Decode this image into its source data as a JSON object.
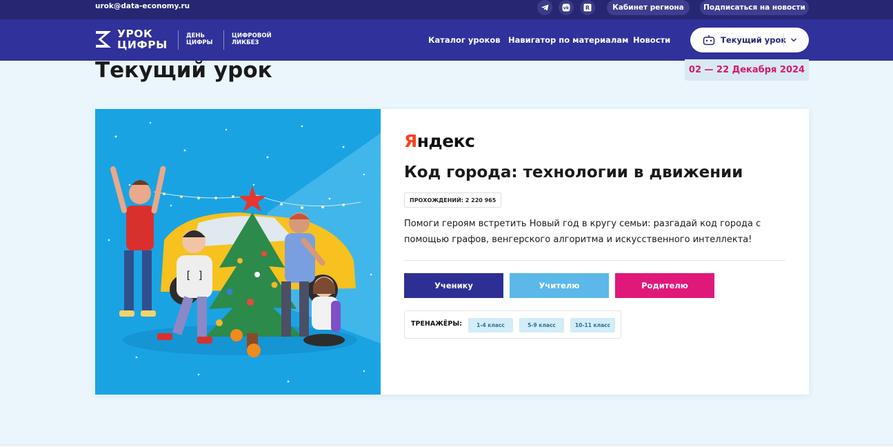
{
  "topbar": {
    "email": "urok@data-economy.ru",
    "social": [
      {
        "name": "telegram-icon",
        "glyph": "➤"
      },
      {
        "name": "vk-icon",
        "glyph": "vk"
      },
      {
        "name": "rutube-icon",
        "glyph": "R"
      }
    ],
    "region_cabinet": "Кабинет региона",
    "subscribe": "Подписаться на новости"
  },
  "header": {
    "logo_line1": "УРОК",
    "logo_line2": "ЦИФРЫ",
    "sub1_line1": "ДЕНЬ",
    "sub1_line2": "ЦИФРЫ",
    "sub2_line1": "ЦИФРОВОЙ",
    "sub2_line2": "ЛИКБЕЗ",
    "nav": [
      "Каталог уроков",
      "Навигатор по материалам",
      "Новости"
    ],
    "current_lesson_button": "Текущий урок"
  },
  "page": {
    "title": "Текущий урок",
    "dates": "02 — 22 Декабря 2024"
  },
  "lesson": {
    "partner_y": "Я",
    "partner_rest": "ндекс",
    "title": "Код города: технологии в движении",
    "passes": "ПРОХОЖДЕНИЙ: 2 220 965",
    "description": "Помоги героям встретить Новый год в кругу семьи: разгадай код города с помощью графов, венгерского алгоритма и искусственного интеллекта!",
    "roles": [
      "Ученику",
      "Учителю",
      "Родителю"
    ],
    "trainers_label": "ТРЕНАЖЁРЫ:",
    "grades": [
      "1-4 класс",
      "5-9 класс",
      "10-11 класс"
    ]
  },
  "colors": {
    "topbar": "#262673",
    "header": "#30319a",
    "student": "#2e2f95",
    "teacher": "#5bb8e8",
    "parent": "#e0187a",
    "accent_pink": "#d8176e",
    "yandex_red": "#fc3f1d"
  }
}
